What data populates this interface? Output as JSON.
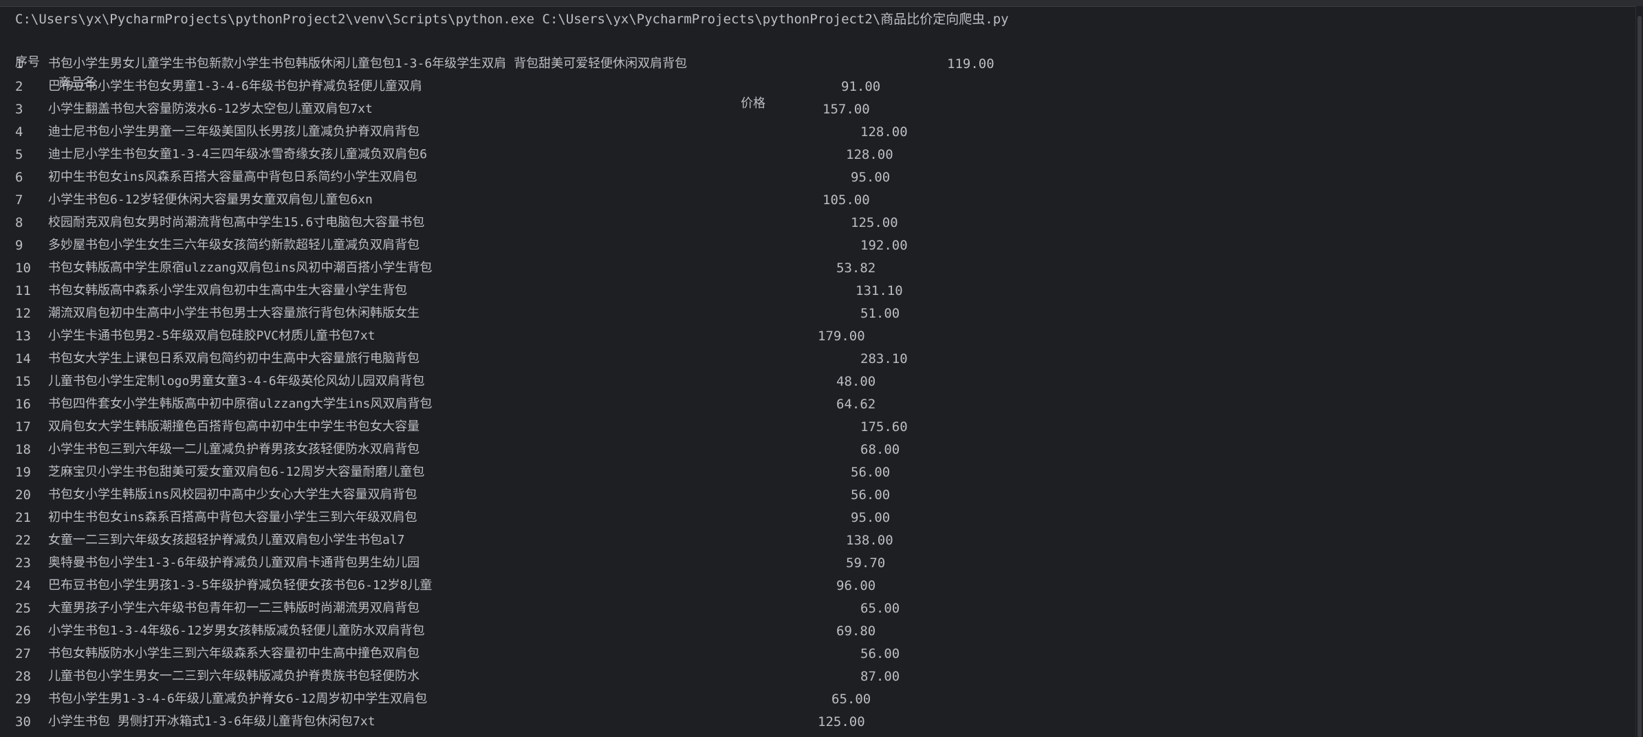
{
  "command": "C:\\Users\\yx\\PycharmProjects\\pythonProject2\\venv\\Scripts\\python.exe C:\\Users\\yx\\PycharmProjects\\pythonProject2\\商品比价定向爬虫.py",
  "header": {
    "index": "序号",
    "name": "商品名",
    "price": "价格"
  },
  "rows": [
    {
      "index": "1",
      "name": "书包小学生男女儿童学生书包新款小学生书包韩版休闲儿童包包1-3-6年级学生双肩 背包甜美可爱轻便休闲双肩背包",
      "price": "119.00"
    },
    {
      "index": "2",
      "name": "巴布豆书小学生书包女男童1-3-4-6年级书包护脊减负轻便儿童双肩",
      "price": "91.00"
    },
    {
      "index": "3",
      "name": "小学生翻盖书包大容量防泼水6-12岁太空包儿童双肩包7xt",
      "price": "157.00"
    },
    {
      "index": "4",
      "name": "迪士尼书包小学生男童一三年级美国队长男孩儿童减负护脊双肩背包",
      "price": "128.00"
    },
    {
      "index": "5",
      "name": "迪士尼小学生书包女童1-3-4三四年级冰雪奇缘女孩儿童减负双肩包6",
      "price": "128.00"
    },
    {
      "index": "6",
      "name": "初中生书包女ins风森系百搭大容量高中背包日系简约小学生双肩包",
      "price": "95.00"
    },
    {
      "index": "7",
      "name": "小学生书包6-12岁轻便休闲大容量男女童双肩包儿童包6xn",
      "price": "105.00"
    },
    {
      "index": "8",
      "name": "校园耐克双肩包女男时尚潮流背包高中学生15.6寸电脑包大容量书包",
      "price": "125.00"
    },
    {
      "index": "9",
      "name": "多妙屋书包小学生女生三六年级女孩简约新款超轻儿童减负双肩背包",
      "price": "192.00"
    },
    {
      "index": "10",
      "name": "书包女韩版高中学生原宿ulzzang双肩包ins风初中潮百搭小学生背包",
      "price": "53.82"
    },
    {
      "index": "11",
      "name": "书包女韩版高中森系小学生双肩包初中生高中生大容量小学生背包",
      "price": "131.10"
    },
    {
      "index": "12",
      "name": "潮流双肩包初中生高中小学生书包男士大容量旅行背包休闲韩版女生",
      "price": "51.00"
    },
    {
      "index": "13",
      "name": "小学生卡通书包男2-5年级双肩包硅胶PVC材质儿童书包7xt",
      "price": "179.00"
    },
    {
      "index": "14",
      "name": "书包女大学生上课包日系双肩包简约初中生高中大容量旅行电脑背包",
      "price": "283.10"
    },
    {
      "index": "15",
      "name": "儿童书包小学生定制logo男童女童3-4-6年级英伦风幼儿园双肩背包",
      "price": "48.00"
    },
    {
      "index": "16",
      "name": "书包四件套女小学生韩版高中初中原宿ulzzang大学生ins风双肩背包",
      "price": "64.62"
    },
    {
      "index": "17",
      "name": "双肩包女大学生韩版潮撞色百搭背包高中初中生中学生书包女大容量",
      "price": "175.60"
    },
    {
      "index": "18",
      "name": "小学生书包三到六年级一二儿童减负护脊男孩女孩轻便防水双肩背包",
      "price": "68.00"
    },
    {
      "index": "19",
      "name": "芝麻宝贝小学生书包甜美可爱女童双肩包6-12周岁大容量耐磨儿童包",
      "price": "56.00"
    },
    {
      "index": "20",
      "name": "书包女小学生韩版ins风校园初中高中少女心大学生大容量双肩背包",
      "price": "56.00"
    },
    {
      "index": "21",
      "name": "初中生书包女ins森系百搭高中背包大容量小学生三到六年级双肩包",
      "price": "95.00"
    },
    {
      "index": "22",
      "name": "女童一二三到六年级女孩超轻护脊减负儿童双肩包小学生书包al7",
      "price": "138.00"
    },
    {
      "index": "23",
      "name": "奥特曼书包小学生1-3-6年级护脊减负儿童双肩卡通背包男生幼儿园",
      "price": "59.70"
    },
    {
      "index": "24",
      "name": "巴布豆书包小学生男孩1-3-5年级护脊减负轻便女孩书包6-12岁8儿童",
      "price": "96.00"
    },
    {
      "index": "25",
      "name": "大童男孩子小学生六年级书包青年初一二三韩版时尚潮流男双肩背包",
      "price": "65.00"
    },
    {
      "index": "26",
      "name": "小学生书包1-3-4年级6-12岁男女孩韩版减负轻便儿童防水双肩背包",
      "price": "69.80"
    },
    {
      "index": "27",
      "name": "书包女韩版防水小学生三到六年级森系大容量初中生高中撞色双肩包",
      "price": "56.00"
    },
    {
      "index": "28",
      "name": "儿童书包小学生男女一二三到六年级韩版减负护脊贵族书包轻便防水",
      "price": "87.00"
    },
    {
      "index": "29",
      "name": "书包小学生男1-3-4-6年级儿童减负护脊女6-12周岁初中学生双肩包",
      "price": "65.00"
    },
    {
      "index": "30",
      "name": "小学生书包 男侧打开冰箱式1-3-6年级儿童背包休闲包7xt",
      "price": "125.00"
    }
  ]
}
